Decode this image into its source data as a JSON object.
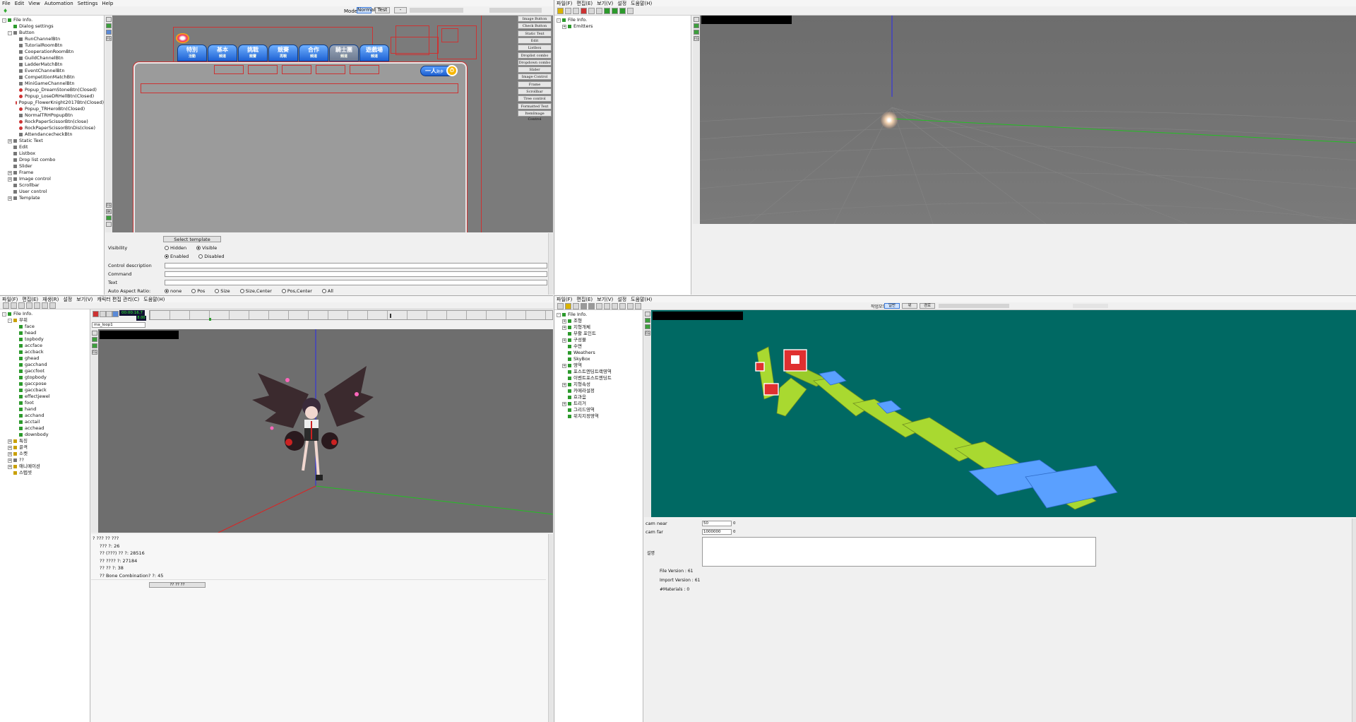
{
  "q1": {
    "menu": [
      "File",
      "Edit",
      "View",
      "Automation",
      "Settings",
      "Help"
    ],
    "mode_label": "Mode:",
    "mode_options": [
      "Normal",
      "Test",
      "-"
    ],
    "tree": [
      {
        "d": 0,
        "exp": "-",
        "ico": "green",
        "t": "File Info."
      },
      {
        "d": 1,
        "exp": "",
        "ico": "green",
        "t": "Dialog settings"
      },
      {
        "d": 1,
        "exp": "-",
        "ico": "gray",
        "t": "Button"
      },
      {
        "d": 2,
        "exp": "",
        "ico": "gray",
        "t": "RunChannelBtn"
      },
      {
        "d": 2,
        "exp": "",
        "ico": "gray",
        "t": "TutorialRoomBtn"
      },
      {
        "d": 2,
        "exp": "",
        "ico": "gray",
        "t": "CooperationRoomBtn"
      },
      {
        "d": 2,
        "exp": "",
        "ico": "gray",
        "t": "GuildChannelBtn"
      },
      {
        "d": 2,
        "exp": "",
        "ico": "gray",
        "t": "LadderMatchBtn"
      },
      {
        "d": 2,
        "exp": "",
        "ico": "gray",
        "t": "EventChannelBtn"
      },
      {
        "d": 2,
        "exp": "",
        "ico": "gray",
        "t": "CompetitionMatchBtn"
      },
      {
        "d": 2,
        "exp": "",
        "ico": "gray",
        "t": "MiniGameChannelBtn"
      },
      {
        "d": 2,
        "exp": "",
        "ico": "red",
        "t": "Popup_DreamStoneBtn(Closed)"
      },
      {
        "d": 2,
        "exp": "",
        "ico": "red",
        "t": "Popup_LoseDRHellBtn(Closed)"
      },
      {
        "d": 2,
        "exp": "",
        "ico": "red",
        "t": "Popup_FlowerKnight2017Btn(Closed)"
      },
      {
        "d": 2,
        "exp": "",
        "ico": "red",
        "t": "Popup_TRHeroBtn(Closed)"
      },
      {
        "d": 2,
        "exp": "",
        "ico": "gray",
        "t": "NormalTRHPopupBtn"
      },
      {
        "d": 2,
        "exp": "",
        "ico": "red",
        "t": "RockPaperScissorBtn(close)"
      },
      {
        "d": 2,
        "exp": "",
        "ico": "red",
        "t": "RockPaperScissorBtnDis(close)"
      },
      {
        "d": 2,
        "exp": "",
        "ico": "gray",
        "t": "AttendancecheckBtn"
      },
      {
        "d": 1,
        "exp": "+",
        "ico": "gray",
        "t": "Static Text"
      },
      {
        "d": 1,
        "exp": "",
        "ico": "gray",
        "t": "Edit"
      },
      {
        "d": 1,
        "exp": "",
        "ico": "gray",
        "t": "Listbox"
      },
      {
        "d": 1,
        "exp": "",
        "ico": "gray",
        "t": "Drop list combo"
      },
      {
        "d": 1,
        "exp": "",
        "ico": "gray",
        "t": "Slider"
      },
      {
        "d": 1,
        "exp": "+",
        "ico": "gray",
        "t": "Frame"
      },
      {
        "d": 1,
        "exp": "+",
        "ico": "gray",
        "t": "Image control"
      },
      {
        "d": 1,
        "exp": "",
        "ico": "gray",
        "t": "Scrollbar"
      },
      {
        "d": 1,
        "exp": "",
        "ico": "gray",
        "t": "User control"
      },
      {
        "d": 1,
        "exp": "+",
        "ico": "gray",
        "t": "Template"
      }
    ],
    "tabs": [
      {
        "main": "特別",
        "sub": "活動"
      },
      {
        "main": "基本",
        "sub": "頻道"
      },
      {
        "main": "挑戰",
        "sub": "競賽"
      },
      {
        "main": "競賽",
        "sub": "再戰"
      },
      {
        "main": "合作",
        "sub": "頻道"
      },
      {
        "main": "騎士團",
        "sub": "頻道"
      },
      {
        "main": "遊戲場",
        "sub": "頻道"
      }
    ],
    "solo_button": "一人",
    "solo_sub": "跑步",
    "palette": [
      "Image Button",
      "Check Button",
      "Static Text",
      "Edit",
      "Listbox",
      "Droplist combo",
      "Dropdown combo",
      "Slider",
      "Image Control",
      "Frame",
      "Scrollbar",
      "Tree control",
      "Formatted Text",
      "ItemImage Control"
    ],
    "select_template": "Select template",
    "visibility_label": "Visibility",
    "vis_opts": [
      "Hidden",
      "Visible"
    ],
    "en_opts": [
      "Enabled",
      "Disabled"
    ],
    "fields": [
      "Control description",
      "Command",
      "Text"
    ],
    "aspect_label": "Auto Aspect Ratio:",
    "aspect_opts": [
      "none",
      "Pos",
      "Size",
      "Size,Center",
      "Pos,Center",
      "All"
    ]
  },
  "q2": {
    "menu": [
      "파일(F)",
      "편집(E)",
      "보기(V)",
      "설정",
      "도움말(H)"
    ],
    "tree": [
      {
        "d": 0,
        "exp": "-",
        "t": "File Info."
      },
      {
        "d": 1,
        "exp": "+",
        "t": "Emitters"
      }
    ]
  },
  "q3": {
    "menu": [
      "파일(F)",
      "편집(E)",
      "재생(R)",
      "설정",
      "보기(V)",
      "캐릭터 편집 관리(C)",
      "도움말(H)"
    ],
    "time": "00:00:16.7",
    "frame": "8.00",
    "anim": "ma_loop1",
    "tree": [
      {
        "d": 0,
        "exp": "-",
        "ico": "green",
        "t": "File Info."
      },
      {
        "d": 1,
        "exp": "-",
        "ico": "y",
        "t": "부위"
      },
      {
        "d": 2,
        "exp": "",
        "ico": "green",
        "t": "face"
      },
      {
        "d": 2,
        "exp": "",
        "ico": "green",
        "t": "head"
      },
      {
        "d": 2,
        "exp": "",
        "ico": "green",
        "t": "topbody"
      },
      {
        "d": 2,
        "exp": "",
        "ico": "green",
        "t": "accface"
      },
      {
        "d": 2,
        "exp": "",
        "ico": "green",
        "t": "accback"
      },
      {
        "d": 2,
        "exp": "",
        "ico": "green",
        "t": "ghead"
      },
      {
        "d": 2,
        "exp": "",
        "ico": "green",
        "t": "gacchand"
      },
      {
        "d": 2,
        "exp": "",
        "ico": "green",
        "t": "gaccfoot"
      },
      {
        "d": 2,
        "exp": "",
        "ico": "green",
        "t": "gtopbody"
      },
      {
        "d": 2,
        "exp": "",
        "ico": "green",
        "t": "gaccpose"
      },
      {
        "d": 2,
        "exp": "",
        "ico": "green",
        "t": "gaccback"
      },
      {
        "d": 2,
        "exp": "",
        "ico": "green",
        "t": "effectjewel"
      },
      {
        "d": 2,
        "exp": "",
        "ico": "green",
        "t": "foot"
      },
      {
        "d": 2,
        "exp": "",
        "ico": "green",
        "t": "hand"
      },
      {
        "d": 2,
        "exp": "",
        "ico": "green",
        "t": "acchand"
      },
      {
        "d": 2,
        "exp": "",
        "ico": "green",
        "t": "acctail"
      },
      {
        "d": 2,
        "exp": "",
        "ico": "green",
        "t": "acchead"
      },
      {
        "d": 2,
        "exp": "",
        "ico": "green",
        "t": "downbody"
      },
      {
        "d": 1,
        "exp": "+",
        "ico": "y",
        "t": "특징"
      },
      {
        "d": 1,
        "exp": "+",
        "ico": "y",
        "t": "골격"
      },
      {
        "d": 1,
        "exp": "+",
        "ico": "y",
        "t": "소켓"
      },
      {
        "d": 1,
        "exp": "+",
        "ico": "gray",
        "t": "??"
      },
      {
        "d": 1,
        "exp": "+",
        "ico": "y",
        "t": "애니메이션"
      },
      {
        "d": 1,
        "exp": "",
        "ico": "y",
        "t": "스텝셋"
      }
    ],
    "stats": [
      "? ??? ?? ???",
      "??? ?: 26",
      "?? (???) ?? ?: 28516",
      "?? ???? ?: 27184",
      "?? ?? ?: 38",
      "?? Bone Combination? ?: 45"
    ],
    "bottom_btn": "?? ?? ??"
  },
  "q4": {
    "menu": [
      "파일(F)",
      "편집(E)",
      "보기(V)",
      "설정",
      "도움말(H)"
    ],
    "mode_label": "작업모드",
    "mode_opts": [
      "일반",
      "위",
      "경로"
    ],
    "tree": [
      {
        "d": 0,
        "exp": "-",
        "t": "File Info."
      },
      {
        "d": 1,
        "exp": "+",
        "t": "조형"
      },
      {
        "d": 1,
        "exp": "+",
        "t": "지형개체"
      },
      {
        "d": 1,
        "exp": "",
        "t": "부활 포인트"
      },
      {
        "d": 1,
        "exp": "+",
        "t": "구성물"
      },
      {
        "d": 1,
        "exp": "",
        "t": "수면"
      },
      {
        "d": 1,
        "exp": "",
        "t": "Weathers"
      },
      {
        "d": 1,
        "exp": "",
        "t": "SkyBox"
      },
      {
        "d": 1,
        "exp": "+",
        "t": "영역"
      },
      {
        "d": 1,
        "exp": "",
        "t": "포스트엔딩트랙영역"
      },
      {
        "d": 1,
        "exp": "",
        "t": "이벤트포스트엔딩트"
      },
      {
        "d": 1,
        "exp": "+",
        "t": "지형속성"
      },
      {
        "d": 1,
        "exp": "",
        "t": "카메라설정"
      },
      {
        "d": 1,
        "exp": "",
        "t": "효과음"
      },
      {
        "d": 1,
        "exp": "+",
        "t": "트리거"
      },
      {
        "d": 1,
        "exp": "",
        "t": "그리드영역"
      },
      {
        "d": 1,
        "exp": "",
        "t": "위치지정영역"
      }
    ],
    "cam_near_label": "cam near",
    "cam_near": "50",
    "cam_far_label": "cam far",
    "cam_far": "1000000",
    "desc_label": "설명",
    "file_version": "File Version : 61",
    "import_version": "Import Version : 61",
    "materials": "#Materials : 0",
    "zero": "0"
  }
}
